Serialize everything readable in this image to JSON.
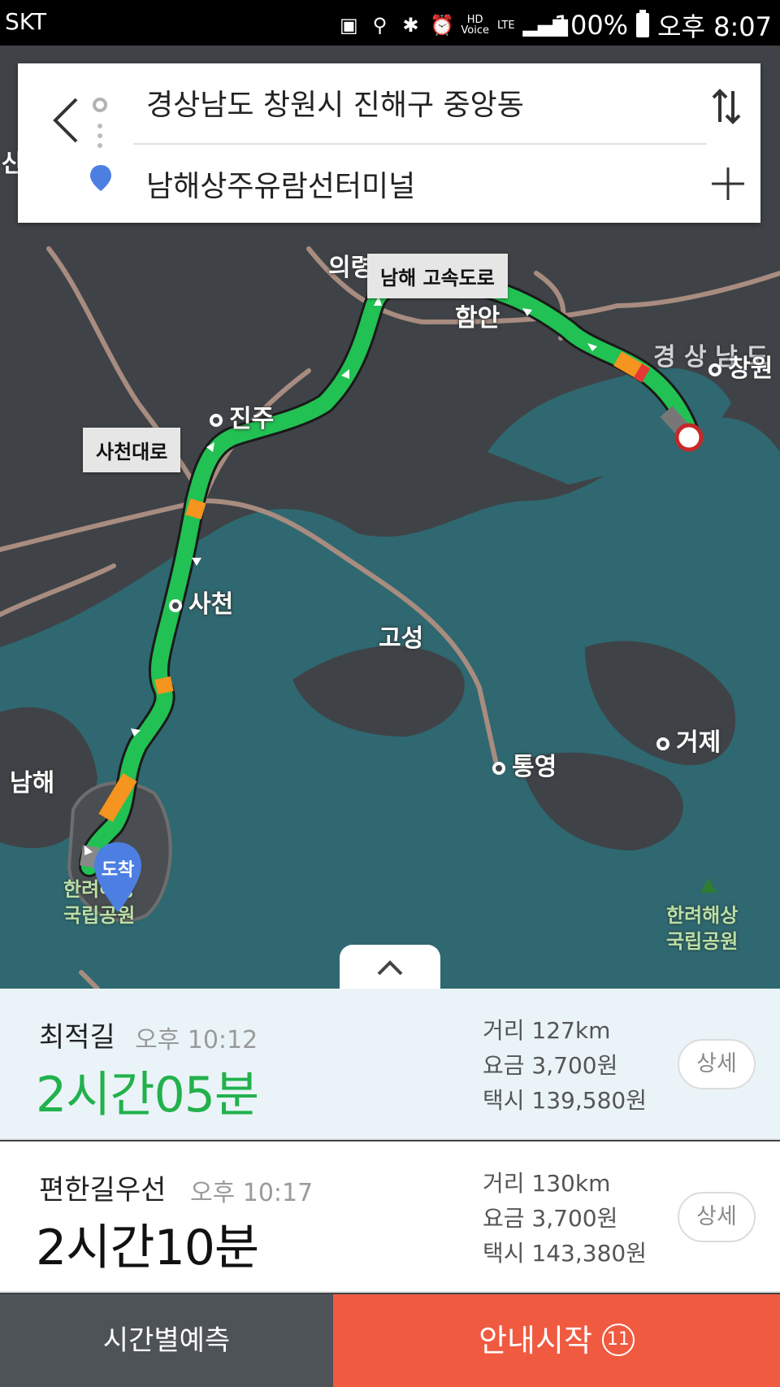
{
  "status_bar": {
    "carrier": "SKT",
    "battery": "100%",
    "time": "오후 8:07",
    "hd_label": "HD",
    "voice_label": "Voice",
    "lte_label": "LTE"
  },
  "search": {
    "origin": "경상남도 창원시 진해구 중앙동",
    "destination": "남해상주유람선터미널"
  },
  "map": {
    "labels": {
      "uiryeong": "의령",
      "haman": "함안",
      "gyeongsangnam": "경 상 남 도",
      "changwon": "창원",
      "jinju": "진주",
      "sacheon": "사천",
      "goseong": "고성",
      "tongyeong": "통영",
      "geoje": "거제",
      "namhae": "남해",
      "san": "산"
    },
    "road_labels": {
      "namhae_expressway": "남해 고속도로",
      "sacheon_daero": "사천대로"
    },
    "parks": {
      "hallyeo_west_line1": "한려해상",
      "hallyeo_west_line2": "국립공원",
      "hallyeo_east_line1": "한려해상",
      "hallyeo_east_line2": "국립공원"
    },
    "arrival_marker": "도착",
    "colors": {
      "route_green": "#22c153",
      "route_orange": "#f5941e",
      "route_red": "#e53935",
      "sea": "#2f6870",
      "land": "#3f4347"
    }
  },
  "routes": [
    {
      "name": "최적길",
      "eta": "오후 10:12",
      "duration": "2시간05분",
      "distance": "거리 127km",
      "toll": "요금 3,700원",
      "taxi": "택시 139,580원",
      "detail_label": "상세"
    },
    {
      "name": "편한길우선",
      "eta": "오후 10:17",
      "duration": "2시간10분",
      "distance": "거리 130km",
      "toll": "요금 3,700원",
      "taxi": "택시 143,380원",
      "detail_label": "상세"
    }
  ],
  "bottom": {
    "forecast_label": "시간별예측",
    "start_label": "안내시작",
    "start_count": "11"
  }
}
